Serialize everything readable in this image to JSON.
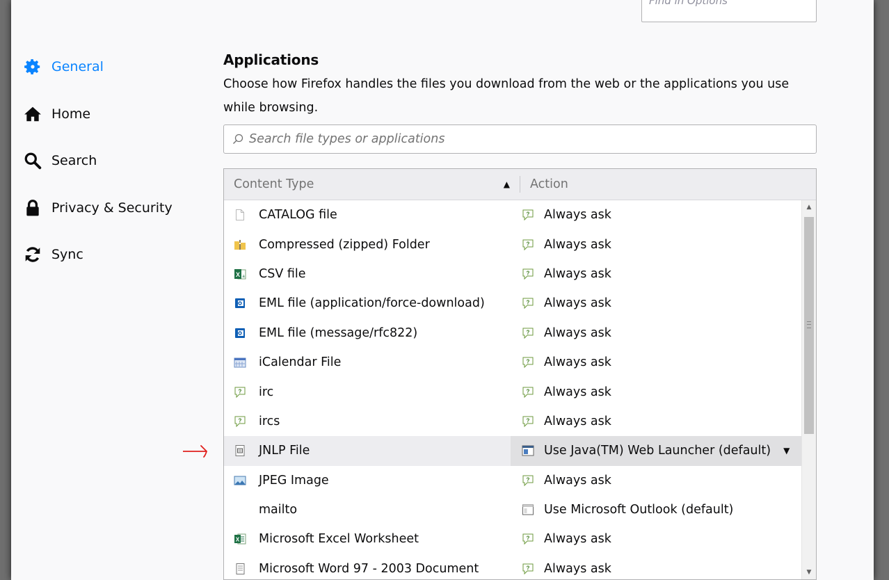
{
  "find": {
    "placeholder": "Find in Options"
  },
  "sidebar": {
    "items": [
      {
        "label": "General",
        "icon": "gear-icon",
        "selected": true
      },
      {
        "label": "Home",
        "icon": "home-icon"
      },
      {
        "label": "Search",
        "icon": "search-icon"
      },
      {
        "label": "Privacy & Security",
        "icon": "lock-icon"
      },
      {
        "label": "Sync",
        "icon": "sync-icon"
      }
    ]
  },
  "applications": {
    "heading": "Applications",
    "description": "Choose how Firefox handles the files you download from the web or the applications you use while browsing.",
    "search_placeholder": "Search file types or applications",
    "columns": {
      "content_type": "Content Type",
      "action": "Action"
    },
    "rows": [
      {
        "type": "CATALOG file",
        "icon": "blank-file-icon",
        "action": "Always ask",
        "action_icon": "ask-icon"
      },
      {
        "type": "Compressed (zipped) Folder",
        "icon": "zip-folder-icon",
        "action": "Always ask",
        "action_icon": "ask-icon"
      },
      {
        "type": "CSV file",
        "icon": "excel-csv-icon",
        "action": "Always ask",
        "action_icon": "ask-icon"
      },
      {
        "type": "EML file (application/force-download)",
        "icon": "outlook-mail-icon",
        "action": "Always ask",
        "action_icon": "ask-icon"
      },
      {
        "type": "EML file (message/rfc822)",
        "icon": "outlook-mail-icon",
        "action": "Always ask",
        "action_icon": "ask-icon"
      },
      {
        "type": "iCalendar File",
        "icon": "calendar-icon",
        "action": "Always ask",
        "action_icon": "ask-icon"
      },
      {
        "type": "irc",
        "icon": "ask-icon",
        "action": "Always ask",
        "action_icon": "ask-icon"
      },
      {
        "type": "ircs",
        "icon": "ask-icon",
        "action": "Always ask",
        "action_icon": "ask-icon"
      },
      {
        "type": "JNLP File",
        "icon": "jnlp-file-icon",
        "action": "Use Java(TM) Web Launcher (default)",
        "action_icon": "java-app-icon",
        "selected": true
      },
      {
        "type": "JPEG Image",
        "icon": "image-icon",
        "action": "Always ask",
        "action_icon": "ask-icon"
      },
      {
        "type": "mailto",
        "icon": "",
        "action": "Use Microsoft Outlook (default)",
        "action_icon": "outlook-app-icon"
      },
      {
        "type": "Microsoft Excel Worksheet",
        "icon": "excel-icon",
        "action": "Always ask",
        "action_icon": "ask-icon"
      },
      {
        "type": "Microsoft Word 97 - 2003 Document",
        "icon": "word-icon",
        "action": "Always ask",
        "action_icon": "ask-icon"
      }
    ]
  },
  "colors": {
    "accent": "#0a84ff",
    "annotation": "#e0201c"
  }
}
